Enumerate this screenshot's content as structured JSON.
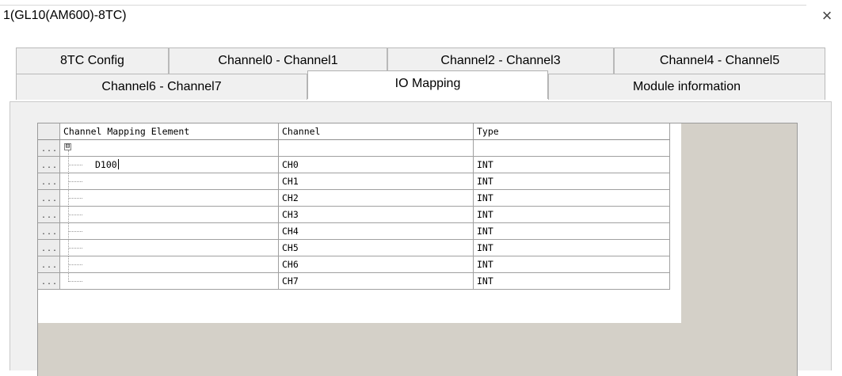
{
  "window": {
    "title": "1(GL10(AM600)-8TC)",
    "close_glyph": "×"
  },
  "tabs": {
    "row1": [
      "8TC Config",
      "Channel0 - Channel1",
      "Channel2 - Channel3",
      "Channel4 - Channel5"
    ],
    "row2": [
      "Channel6 - Channel7",
      "IO Mapping",
      "Module information"
    ],
    "active": "IO Mapping"
  },
  "table": {
    "columns": [
      "Channel Mapping Element",
      "Channel",
      "Type"
    ],
    "row_marker": "...",
    "expander_glyph": "⊟",
    "variable": "D100",
    "rows": [
      {
        "channel": "CH0",
        "type": "INT"
      },
      {
        "channel": "CH1",
        "type": "INT"
      },
      {
        "channel": "CH2",
        "type": "INT"
      },
      {
        "channel": "CH3",
        "type": "INT"
      },
      {
        "channel": "CH4",
        "type": "INT"
      },
      {
        "channel": "CH5",
        "type": "INT"
      },
      {
        "channel": "CH6",
        "type": "INT"
      },
      {
        "channel": "CH7",
        "type": "INT"
      }
    ]
  }
}
